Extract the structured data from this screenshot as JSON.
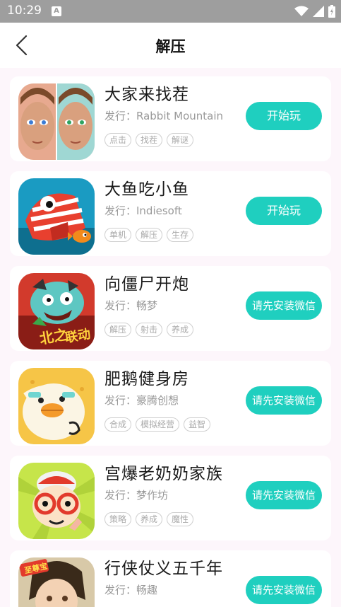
{
  "status": {
    "time": "10:29",
    "notif_icon": "a-icon"
  },
  "header": {
    "title": "解压",
    "back_icon": "chevron-left-icon"
  },
  "colors": {
    "accent": "#1fcfbf",
    "background": "#fdf6fb"
  },
  "games": [
    {
      "title": "大家来找茬",
      "publisher": "发行：Rabbit Mountain",
      "tags": [
        "点击",
        "找茬",
        "解谜"
      ],
      "action": "开始玩",
      "icon": "girl-faces-icon"
    },
    {
      "title": "大鱼吃小鱼",
      "publisher": "发行：Indiesoft",
      "tags": [
        "单机",
        "解压",
        "生存"
      ],
      "action": "开始玩",
      "icon": "fish-icon"
    },
    {
      "title": "向僵尸开炮",
      "publisher": "发行：畅梦",
      "tags": [
        "解压",
        "射击",
        "养成"
      ],
      "action": "请先安装微信",
      "icon": "zombie-icon"
    },
    {
      "title": "肥鹅健身房",
      "publisher": "发行：豪腾创想",
      "tags": [
        "合成",
        "模拟经营",
        "益智"
      ],
      "action": "请先安装微信",
      "icon": "goose-icon"
    },
    {
      "title": "宫爆老奶奶家族",
      "publisher": "发行：梦作坊",
      "tags": [
        "策略",
        "养成",
        "魔性"
      ],
      "action": "请先安装微信",
      "icon": "grandma-icon"
    },
    {
      "title": "行侠仗义五千年",
      "publisher": "发行：畅趣",
      "tags": [],
      "action": "请先安装微信",
      "icon": "hero-icon"
    }
  ]
}
